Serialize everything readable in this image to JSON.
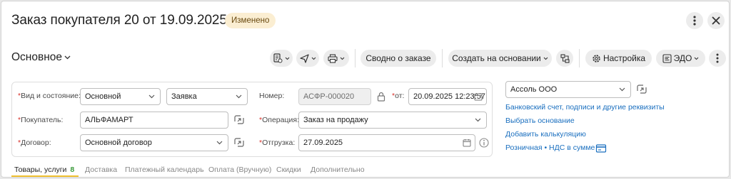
{
  "header": {
    "title": "Заказ покупателя 20 от 19.09.2025",
    "status_badge": "Изменено"
  },
  "toolbar": {
    "section_label": "Основное",
    "summary_button": "Сводно о заказе",
    "create_based_button": "Создать на основании",
    "settings_button": "Настройка",
    "edo_button": "ЭДО"
  },
  "form": {
    "kind_label": "Вид и состояние:",
    "kind_value": "Основной",
    "state_value": "Заявка",
    "number_label": "Номер:",
    "number_value": "АСФР-000020",
    "date_label": "от:",
    "date_value": "20.09.2025 12:23:57",
    "buyer_label": "Покупатель:",
    "buyer_value": "АЛЬФАМАРТ",
    "operation_label": "Операция:",
    "operation_value": "Заказ на продажу",
    "contract_label": "Договор:",
    "contract_value": "Основной договор",
    "shipment_label": "Отгрузка:",
    "shipment_value": "27.09.2025"
  },
  "right_panel": {
    "organization_value": "Ассоль ООО",
    "links": [
      "Банковский счет, подписи и другие реквизиты",
      "Выбрать основание",
      "Добавить калькуляцию",
      "Розничная • НДС в сумме"
    ]
  },
  "tabs": [
    {
      "label": "Товары, услуги",
      "count": "8"
    },
    {
      "label": "Доставка"
    },
    {
      "label": "Платежный календарь"
    },
    {
      "label": "Оплата (Вручную)"
    },
    {
      "label": "Скидки"
    },
    {
      "label": "Дополнительно"
    }
  ],
  "colors": {
    "link": "#1a6fbf",
    "required": "#d8332c",
    "badge_bg": "#fbeed2",
    "active_tab_underline": "#f0c030",
    "tab_count": "#3a9a3a"
  }
}
